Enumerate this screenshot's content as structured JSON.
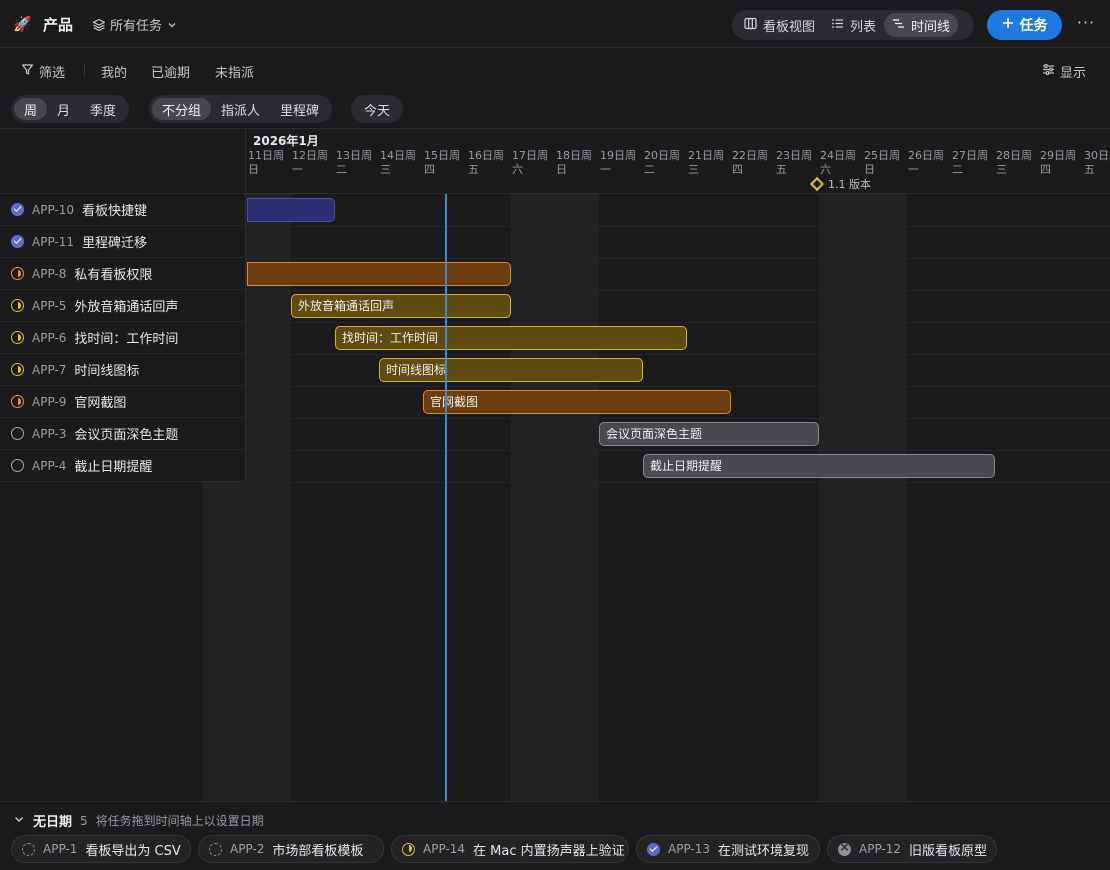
{
  "header": {
    "project_name": "产品",
    "scope_label": "所有任务",
    "views": [
      {
        "label": "看板视图",
        "icon": "board-icon"
      },
      {
        "label": "列表",
        "icon": "list-icon"
      },
      {
        "label": "时间线",
        "icon": "timeline-icon",
        "active": true
      }
    ],
    "new_task_label": "任务",
    "more_label": "···"
  },
  "filters": {
    "filter_label": "筛选",
    "mine_label": "我的",
    "overdue_label": "已逾期",
    "unassigned_label": "未指派",
    "display_label": "显示"
  },
  "zoom": {
    "items": [
      "周",
      "月",
      "季度"
    ],
    "active": "周"
  },
  "grouping": {
    "items": [
      "不分组",
      "指派人",
      "里程碑"
    ],
    "active": "不分组"
  },
  "today_label": "今天",
  "timeline": {
    "month_label": "2026年1月",
    "days": [
      {
        "date": "11日周",
        "weekday": "日",
        "weekend": true
      },
      {
        "date": "12日周",
        "weekday": "一"
      },
      {
        "date": "13日周",
        "weekday": "二"
      },
      {
        "date": "14日周",
        "weekday": "三"
      },
      {
        "date": "15日周",
        "weekday": "四"
      },
      {
        "date": "16日周",
        "weekday": "五"
      },
      {
        "date": "17日周",
        "weekday": "六",
        "weekend": true
      },
      {
        "date": "18日周",
        "weekday": "日",
        "weekend": true
      },
      {
        "date": "19日周",
        "weekday": "一"
      },
      {
        "date": "20日周",
        "weekday": "二"
      },
      {
        "date": "21日周",
        "weekday": "三"
      },
      {
        "date": "22日周",
        "weekday": "四"
      },
      {
        "date": "23日周",
        "weekday": "五"
      },
      {
        "date": "24日周",
        "weekday": "六",
        "weekend": true
      },
      {
        "date": "25日周",
        "weekday": "日",
        "weekend": true
      },
      {
        "date": "26日周",
        "weekday": "一"
      },
      {
        "date": "27日周",
        "weekday": "二"
      },
      {
        "date": "28日周",
        "weekday": "三"
      },
      {
        "date": "29日周",
        "weekday": "四"
      },
      {
        "date": "30日周",
        "weekday": "五"
      }
    ],
    "milestone": {
      "label": "1.1 版本",
      "date_index": 12
    },
    "today_index": 4
  },
  "tasks": [
    {
      "id": "APP-10",
      "title": "看板快捷键",
      "status": "done",
      "start": -2,
      "end": 1,
      "color": "blue",
      "bar_label": ""
    },
    {
      "id": "APP-11",
      "title": "里程碑迁移",
      "status": "done"
    },
    {
      "id": "APP-8",
      "title": "私有看板权限",
      "status": "progress-orange",
      "start": -2,
      "end": 5,
      "color": "orange",
      "bar_label": ""
    },
    {
      "id": "APP-5",
      "title": "外放音箱通话回声",
      "status": "progress-yellow",
      "start": 1,
      "end": 5,
      "color": "yellow",
      "bar_label": "外放音箱通话回声"
    },
    {
      "id": "APP-6",
      "title": "找时间：工作时间",
      "status": "progress-yellow",
      "start": 2,
      "end": 9,
      "color": "yellow",
      "bar_label": "找时间：工作时间"
    },
    {
      "id": "APP-7",
      "title": "时间线图标",
      "status": "progress-yellow",
      "start": 3,
      "end": 8,
      "color": "yellow",
      "bar_label": "时间线图标"
    },
    {
      "id": "APP-9",
      "title": "官网截图",
      "status": "progress-orange",
      "start": 4,
      "end": 10,
      "color": "orange",
      "bar_label": "官网截图"
    },
    {
      "id": "APP-3",
      "title": "会议页面深色主题",
      "status": "todo",
      "start": 8,
      "end": 12,
      "color": "gray",
      "bar_label": "会议页面深色主题"
    },
    {
      "id": "APP-4",
      "title": "截止日期提醒",
      "status": "todo",
      "start": 9,
      "end": 16,
      "color": "gray",
      "bar_label": "截止日期提醒"
    }
  ],
  "no_date": {
    "title": "无日期",
    "count": "5",
    "hint": "将任务拖到时间轴上以设置日期",
    "items": [
      {
        "id": "APP-1",
        "title": "看板导出为 CSV",
        "status": "backlog"
      },
      {
        "id": "APP-2",
        "title": "市场部看板模板",
        "status": "backlog"
      },
      {
        "id": "APP-14",
        "title": "在 Mac 内置扬声器上验证",
        "status": "progress-yellow"
      },
      {
        "id": "APP-13",
        "title": "在测试环境复现",
        "status": "done"
      },
      {
        "id": "APP-12",
        "title": "旧版看板原型",
        "status": "cancelled"
      }
    ]
  }
}
